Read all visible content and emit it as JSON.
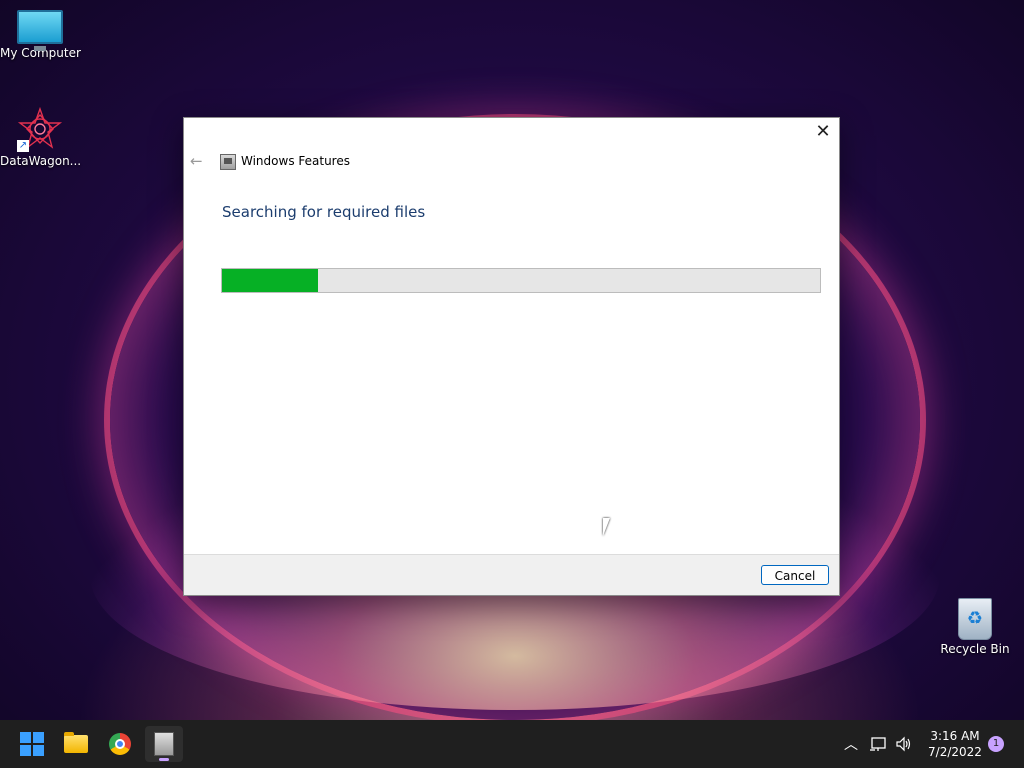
{
  "desktop": {
    "icons": [
      {
        "label": "My Computer",
        "icon": "monitor-icon"
      },
      {
        "label": "DataWagon...",
        "icon": "datawagon-logo-icon"
      },
      {
        "label": "Recycle Bin",
        "icon": "recycle-bin-icon"
      }
    ]
  },
  "dialog": {
    "title": "Windows Features",
    "heading": "Searching for required files",
    "progress_percent": 16,
    "cancel_label": "Cancel",
    "back_icon": "back-arrow-icon",
    "close_icon": "close-icon"
  },
  "taskbar": {
    "apps": [
      "start-icon",
      "file-explorer-icon",
      "chrome-icon",
      "windows-features-icon"
    ],
    "clock": {
      "time": "3:16 AM",
      "date": "7/2/2022"
    },
    "notification_count": "1",
    "tray_icons": [
      "chevron-up-icon",
      "network-icon",
      "volume-icon"
    ]
  },
  "colors": {
    "progress_fill": "#06b025",
    "heading": "#1c3d6e",
    "accent": "#0067c0"
  }
}
